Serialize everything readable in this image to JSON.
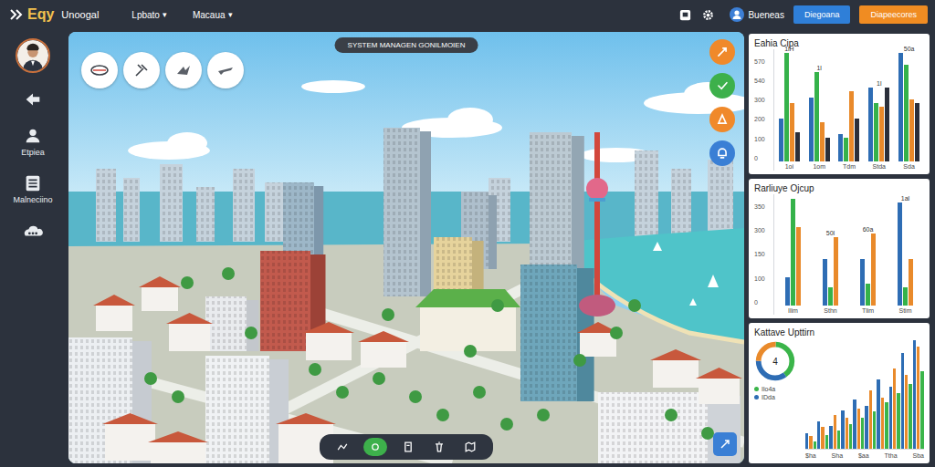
{
  "app": {
    "logo": "Eqy",
    "title": "Unoogal"
  },
  "menus": [
    {
      "label": "Lpbato",
      "arrow": "▾"
    },
    {
      "label": "Macaua",
      "arrow": "▾"
    }
  ],
  "user": {
    "name": "Bueneas"
  },
  "buttons": [
    {
      "label": "Diegoana",
      "color": "#2f7fd8"
    },
    {
      "label": "Diapeecores",
      "color": "#f08c22"
    }
  ],
  "sidebar": {
    "items": [
      {
        "label": "Etpiea"
      },
      {
        "label": "Malneciino"
      }
    ]
  },
  "map": {
    "title": "SYSTEM MANAGEN GONILMOIEN",
    "actions": [
      {
        "color": "#f0892a"
      },
      {
        "color": "#3db04b"
      },
      {
        "color": "#f0892a"
      },
      {
        "color": "#3a7fd5"
      }
    ],
    "tools": [
      {
        "selected": false
      },
      {
        "selected": true
      },
      {
        "selected": false
      },
      {
        "selected": false
      },
      {
        "selected": false
      }
    ]
  },
  "charts": [
    {
      "title": "Eahia Cipa",
      "ticks": [
        "570",
        "540",
        "300",
        "200",
        "100",
        "0"
      ],
      "groups": [
        {
          "label": "1oi",
          "note": "1lH"
        },
        {
          "label": "1om",
          "note": "1l"
        },
        {
          "label": "Tdm"
        },
        {
          "label": "Stda",
          "note": "1l"
        },
        {
          "label": "Sda",
          "note": "50a"
        }
      ],
      "series": [
        {
          "color": "#2e6db4",
          "values": [
            220,
            330,
            140,
            380,
            560
          ]
        },
        {
          "color": "#35b24a",
          "values": [
            560,
            460,
            120,
            300,
            500
          ]
        },
        {
          "color": "#e98a2b",
          "values": [
            300,
            200,
            360,
            280,
            320
          ]
        },
        {
          "color": "#2b2f3a",
          "values": [
            150,
            120,
            220,
            380,
            300
          ]
        }
      ]
    },
    {
      "title": "Rarliuye Ojcup",
      "ticks": [
        "350",
        "300",
        "150",
        "100",
        "0"
      ],
      "groups": [
        {
          "label": "Ilim"
        },
        {
          "label": "Sthn",
          "note": "50l"
        },
        {
          "label": "Tlim",
          "note": "60a"
        },
        {
          "label": "Stim",
          "note": "1al"
        }
      ],
      "series": [
        {
          "color": "#2e6db4",
          "values": [
            90,
            150,
            150,
            330
          ]
        },
        {
          "color": "#35b24a",
          "values": [
            340,
            60,
            70,
            60
          ]
        },
        {
          "color": "#e98a2b",
          "values": [
            250,
            220,
            230,
            150
          ]
        }
      ]
    }
  ],
  "kpi": {
    "title": "Kattave Upttirn",
    "donut": {
      "center": "4",
      "segments": [
        {
          "value": 40,
          "color": "#3bb54a"
        },
        {
          "value": 35,
          "color": "#2e6db4"
        },
        {
          "value": 25,
          "color": "#e98a2b"
        }
      ]
    },
    "legend": [
      "Ilo4a",
      "IDda"
    ],
    "series": [
      {
        "color": "#2e6db4",
        "values": [
          10,
          18,
          15,
          25,
          32,
          28,
          45,
          40,
          62,
          70
        ]
      },
      {
        "color": "#e98a2b",
        "values": [
          8,
          14,
          22,
          20,
          26,
          38,
          33,
          52,
          48,
          66
        ]
      },
      {
        "color": "#3bb54a",
        "values": [
          5,
          9,
          12,
          16,
          20,
          24,
          30,
          36,
          42,
          50
        ]
      }
    ],
    "labels": [
      "$ha",
      "Sha",
      "$aa",
      "Ttha",
      "Sba"
    ]
  }
}
